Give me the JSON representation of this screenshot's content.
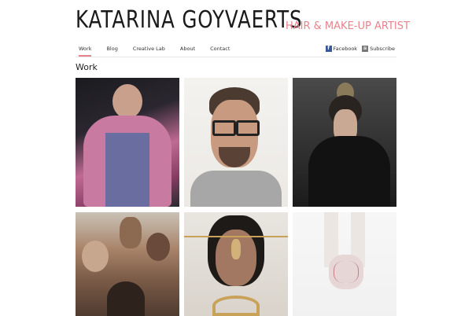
{
  "header": {
    "site_title": "KATARINA GOYVAERTS",
    "tagline": "HAIR & MAKE-UP ARTIST"
  },
  "nav": {
    "items": [
      {
        "label": "Work",
        "active": true
      },
      {
        "label": "Blog",
        "active": false
      },
      {
        "label": "Creative Lab",
        "active": false
      },
      {
        "label": "About",
        "active": false
      },
      {
        "label": "Contact",
        "active": false
      }
    ],
    "social": [
      {
        "label": "Facebook",
        "icon": "facebook-icon"
      },
      {
        "label": "Subscribe",
        "icon": "rss-icon"
      }
    ]
  },
  "main": {
    "section_title": "Work",
    "gallery": [
      {
        "name": "portfolio-image-pink-coat-model"
      },
      {
        "name": "portfolio-image-man-glasses"
      },
      {
        "name": "portfolio-image-fur-coat-updo"
      },
      {
        "name": "portfolio-image-crowd-raised-hands"
      },
      {
        "name": "portfolio-image-gold-headpiece"
      },
      {
        "name": "portfolio-image-hands-white"
      }
    ]
  },
  "colors": {
    "accent": "#e8838b",
    "text": "#222222",
    "divider": "#e5e5e5"
  }
}
